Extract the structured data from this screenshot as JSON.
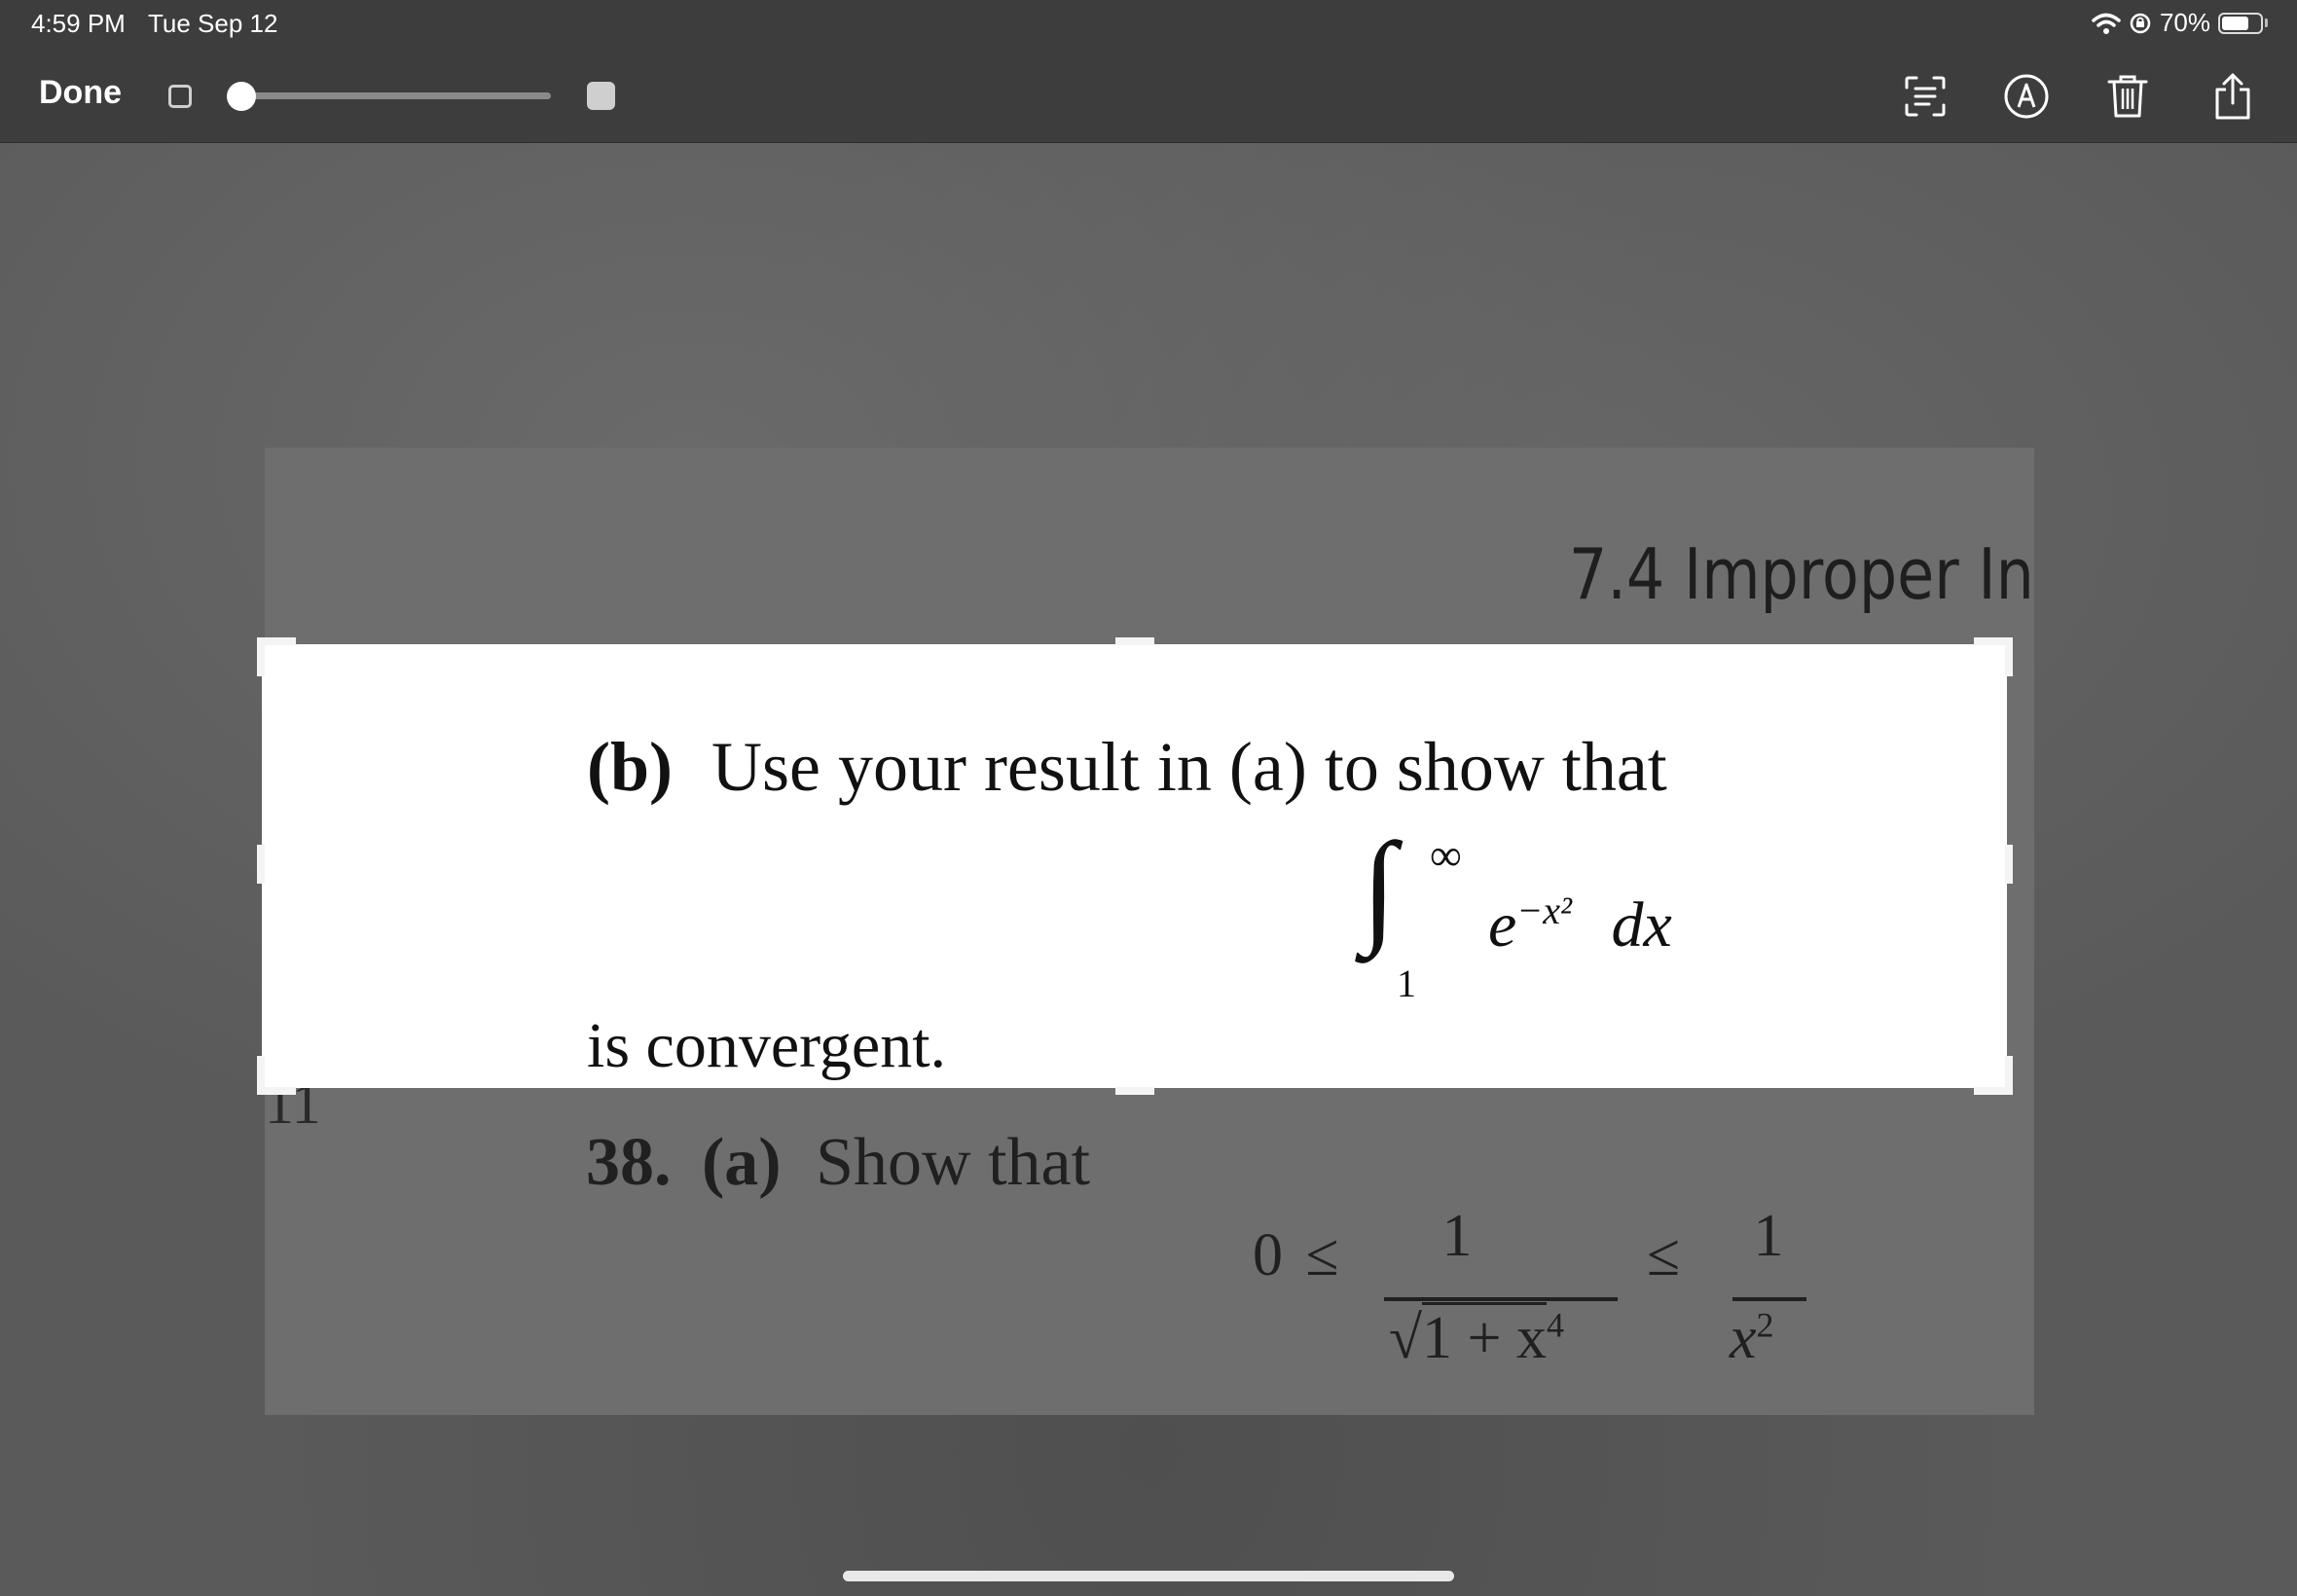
{
  "status": {
    "time": "4:59 PM",
    "date": "Tue Sep 12",
    "battery": "70%",
    "battery_level": 0.7
  },
  "toolbar": {
    "done_label": "Done",
    "brush_size_level": 0.0,
    "icons": [
      "text-recognition-icon",
      "markup-icon",
      "trash-icon",
      "share-icon"
    ]
  },
  "document": {
    "heading": "7.4 Improper In",
    "left_fragment": "11",
    "part_b_label": "(b)",
    "part_b_text": "Use your result in (a) to show that",
    "integral_upper": "∞",
    "integral_lower": "1",
    "integrand_base": "e",
    "integrand_exponent": "−x²",
    "integrand_dx": "dx",
    "convergent_text": "is convergent.",
    "problem_number": "38.",
    "part_a_label": "(a)",
    "part_a_text": "Show that",
    "ineq_zero": "0",
    "ineq_le": "≤",
    "frac1_num": "1",
    "frac1_den": "1 + x",
    "frac1_den_exp": "4",
    "frac2_num": "1",
    "frac2_den": "x",
    "frac2_den_exp": "2"
  }
}
